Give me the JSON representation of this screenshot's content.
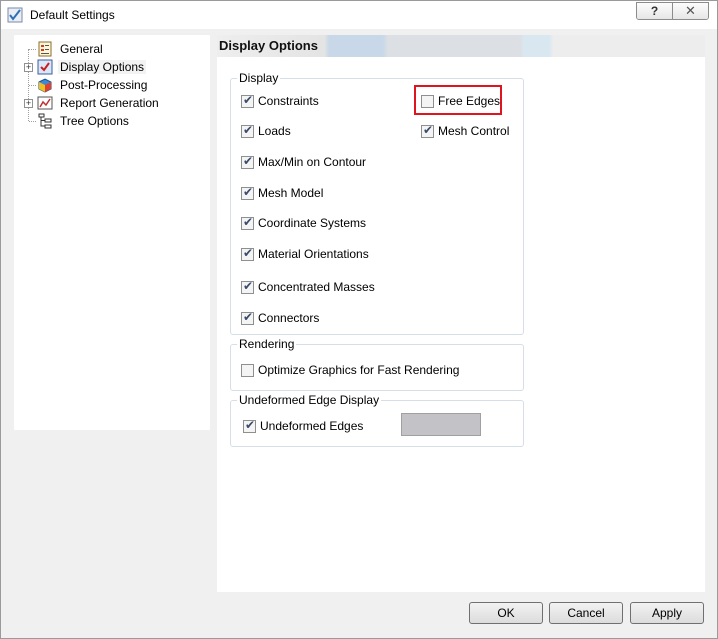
{
  "window": {
    "title": "Default Settings",
    "help_button": "?",
    "close_button": "✕"
  },
  "tree": {
    "items": [
      {
        "label": "General",
        "icon": "general-settings-icon",
        "expandable": false
      },
      {
        "label": "Display Options",
        "icon": "display-options-icon",
        "expandable": true,
        "selected": true
      },
      {
        "label": "Post-Processing",
        "icon": "post-processing-icon",
        "expandable": false
      },
      {
        "label": "Report Generation",
        "icon": "report-generation-icon",
        "expandable": true
      },
      {
        "label": "Tree Options",
        "icon": "tree-options-icon",
        "expandable": false
      }
    ]
  },
  "panel": {
    "title": "Display Options",
    "display_group": {
      "legend": "Display",
      "left": [
        {
          "label": "Constraints",
          "checked": true
        },
        {
          "label": "Loads",
          "checked": true
        },
        {
          "label": "Max/Min on Contour",
          "checked": true
        },
        {
          "label": "Mesh Model",
          "checked": true
        },
        {
          "label": "Coordinate Systems",
          "checked": true
        },
        {
          "label": "Material Orientations",
          "checked": true
        },
        {
          "label": "Concentrated Masses",
          "checked": true
        },
        {
          "label": "Connectors",
          "checked": true
        }
      ],
      "right": [
        {
          "label": "Free Edges",
          "checked": false,
          "highlighted": true
        },
        {
          "label": "Mesh Control",
          "checked": true
        }
      ]
    },
    "rendering_group": {
      "legend": "Rendering",
      "option": {
        "label": "Optimize Graphics for Fast Rendering",
        "checked": false
      }
    },
    "undeformed_group": {
      "legend": "Undeformed Edge Display",
      "option": {
        "label": "Undeformed Edges",
        "checked": true
      },
      "swatch_color": "#c3c3c7"
    }
  },
  "buttons": {
    "ok": "OK",
    "cancel": "Cancel",
    "apply": "Apply"
  },
  "colors": {
    "highlight": "#e0141e",
    "window_bg": "#f0f0f0"
  }
}
